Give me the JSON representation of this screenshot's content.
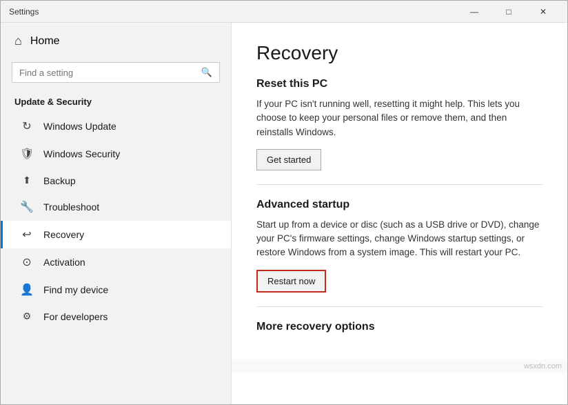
{
  "window": {
    "title": "Settings",
    "controls": {
      "minimize": "—",
      "maximize": "□",
      "close": "✕"
    }
  },
  "sidebar": {
    "home_label": "Home",
    "search_placeholder": "Find a setting",
    "section_title": "Update & Security",
    "items": [
      {
        "id": "windows-update",
        "label": "Windows Update",
        "icon": "↻"
      },
      {
        "id": "windows-security",
        "label": "Windows Security",
        "icon": "🛡"
      },
      {
        "id": "backup",
        "label": "Backup",
        "icon": "↑"
      },
      {
        "id": "troubleshoot",
        "label": "Troubleshoot",
        "icon": "🔧"
      },
      {
        "id": "recovery",
        "label": "Recovery",
        "icon": "↩"
      },
      {
        "id": "activation",
        "label": "Activation",
        "icon": "⊙"
      },
      {
        "id": "find-my-device",
        "label": "Find my device",
        "icon": "👤"
      },
      {
        "id": "for-developers",
        "label": "For developers",
        "icon": "⚙"
      }
    ]
  },
  "main": {
    "page_title": "Recovery",
    "sections": [
      {
        "id": "reset-this-pc",
        "title": "Reset this PC",
        "description": "If your PC isn't running well, resetting it might help. This lets you choose to keep your personal files or remove them, and then reinstalls Windows.",
        "button_label": "Get started"
      },
      {
        "id": "advanced-startup",
        "title": "Advanced startup",
        "description": "Start up from a device or disc (such as a USB drive or DVD), change your PC's firmware settings, change Windows startup settings, or restore Windows from a system image. This will restart your PC.",
        "button_label": "Restart now"
      },
      {
        "id": "more-recovery",
        "title": "More recovery options",
        "description": ""
      }
    ]
  },
  "footer": {
    "watermark": "wsxdn.com"
  }
}
